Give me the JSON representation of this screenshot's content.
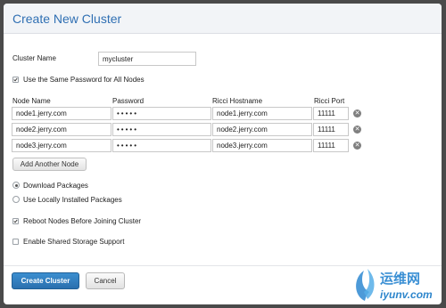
{
  "dialog": {
    "title": "Create New Cluster",
    "cluster_name_label": "Cluster Name",
    "cluster_name_value": "mycluster",
    "same_password_label": "Use the Same Password for All Nodes",
    "same_password_checked": true
  },
  "table": {
    "headers": [
      "Node Name",
      "Password",
      "Ricci Hostname",
      "Ricci Port"
    ],
    "rows": [
      {
        "node_name": "node1.jerry.com",
        "password": "•••••",
        "ricci_hostname": "node1.jerry.com",
        "ricci_port": "11111"
      },
      {
        "node_name": "node2.jerry.com",
        "password": "•••••",
        "ricci_hostname": "node2.jerry.com",
        "ricci_port": "11111"
      },
      {
        "node_name": "node3.jerry.com",
        "password": "•••••",
        "ricci_hostname": "node3.jerry.com",
        "ricci_port": "11111"
      }
    ],
    "remove_glyph": "✕",
    "add_node_label": "Add Another Node"
  },
  "packages": {
    "download_label": "Download Packages",
    "local_label": "Use Locally Installed Packages",
    "selected": "download"
  },
  "options": {
    "reboot_label": "Reboot Nodes Before Joining Cluster",
    "reboot_checked": true,
    "shared_storage_label": "Enable Shared Storage Support",
    "shared_storage_checked": false
  },
  "footer": {
    "create_label": "Create Cluster",
    "cancel_label": "Cancel"
  },
  "watermark": {
    "text_cn": "运维网",
    "url": "iyunv.com"
  },
  "colors": {
    "title": "#2f6fb3",
    "primary": "#2a6fae",
    "overlay": "#4a4a4a"
  },
  "icons": {
    "checkbox_checked": "checkmark-icon",
    "remove": "remove-circle-icon",
    "radio_selected": "radio-dot-icon"
  }
}
